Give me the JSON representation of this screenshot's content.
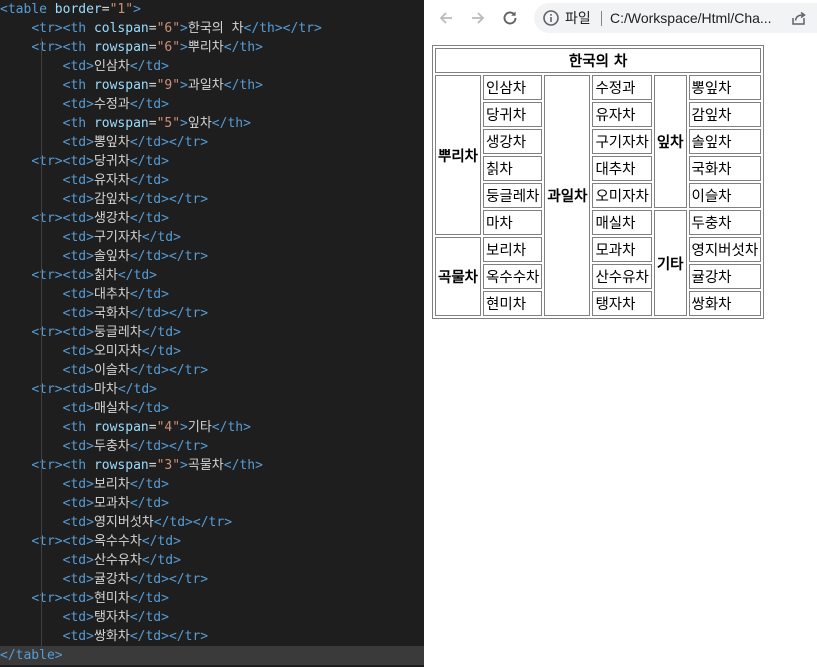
{
  "editor": {
    "lines": [
      [
        {
          "c": "t",
          "v": "<table "
        },
        {
          "c": "a",
          "v": "border"
        },
        {
          "c": "x",
          "v": "="
        },
        {
          "c": "s",
          "v": "\"1\""
        },
        {
          "c": "t",
          "v": ">"
        }
      ],
      [
        {
          "c": "x",
          "v": "    "
        },
        {
          "c": "t",
          "v": "<tr><th "
        },
        {
          "c": "a",
          "v": "colspan"
        },
        {
          "c": "x",
          "v": "="
        },
        {
          "c": "s",
          "v": "\"6\""
        },
        {
          "c": "t",
          "v": ">"
        },
        {
          "c": "x",
          "v": "한국의 차"
        },
        {
          "c": "t",
          "v": "</th></tr>"
        }
      ],
      [
        {
          "c": "x",
          "v": "    "
        },
        {
          "c": "t",
          "v": "<tr><th "
        },
        {
          "c": "a",
          "v": "rowspan"
        },
        {
          "c": "x",
          "v": "="
        },
        {
          "c": "s",
          "v": "\"6\""
        },
        {
          "c": "t",
          "v": ">"
        },
        {
          "c": "x",
          "v": "뿌리차"
        },
        {
          "c": "t",
          "v": "</th>"
        }
      ],
      [
        {
          "c": "x",
          "v": "        "
        },
        {
          "c": "t",
          "v": "<td>"
        },
        {
          "c": "x",
          "v": "인삼차"
        },
        {
          "c": "t",
          "v": "</td>"
        }
      ],
      [
        {
          "c": "x",
          "v": "        "
        },
        {
          "c": "t",
          "v": "<th "
        },
        {
          "c": "a",
          "v": "rowspan"
        },
        {
          "c": "x",
          "v": "="
        },
        {
          "c": "s",
          "v": "\"9\""
        },
        {
          "c": "t",
          "v": ">"
        },
        {
          "c": "x",
          "v": "과일차"
        },
        {
          "c": "t",
          "v": "</th>"
        }
      ],
      [
        {
          "c": "x",
          "v": "        "
        },
        {
          "c": "t",
          "v": "<td>"
        },
        {
          "c": "x",
          "v": "수정과"
        },
        {
          "c": "t",
          "v": "</td>"
        }
      ],
      [
        {
          "c": "x",
          "v": "        "
        },
        {
          "c": "t",
          "v": "<th "
        },
        {
          "c": "a",
          "v": "rowspan"
        },
        {
          "c": "x",
          "v": "="
        },
        {
          "c": "s",
          "v": "\"5\""
        },
        {
          "c": "t",
          "v": ">"
        },
        {
          "c": "x",
          "v": "잎차"
        },
        {
          "c": "t",
          "v": "</th>"
        }
      ],
      [
        {
          "c": "x",
          "v": "        "
        },
        {
          "c": "t",
          "v": "<td>"
        },
        {
          "c": "x",
          "v": "뽕잎차"
        },
        {
          "c": "t",
          "v": "</td></tr>"
        }
      ],
      [
        {
          "c": "x",
          "v": "    "
        },
        {
          "c": "t",
          "v": "<tr><td>"
        },
        {
          "c": "x",
          "v": "당귀차"
        },
        {
          "c": "t",
          "v": "</td>"
        }
      ],
      [
        {
          "c": "x",
          "v": "        "
        },
        {
          "c": "t",
          "v": "<td>"
        },
        {
          "c": "x",
          "v": "유자차"
        },
        {
          "c": "t",
          "v": "</td>"
        }
      ],
      [
        {
          "c": "x",
          "v": "        "
        },
        {
          "c": "t",
          "v": "<td>"
        },
        {
          "c": "x",
          "v": "감잎차"
        },
        {
          "c": "t",
          "v": "</td></tr>"
        }
      ],
      [
        {
          "c": "x",
          "v": "    "
        },
        {
          "c": "t",
          "v": "<tr><td>"
        },
        {
          "c": "x",
          "v": "생강차"
        },
        {
          "c": "t",
          "v": "</td>"
        }
      ],
      [
        {
          "c": "x",
          "v": "        "
        },
        {
          "c": "t",
          "v": "<td>"
        },
        {
          "c": "x",
          "v": "구기자차"
        },
        {
          "c": "t",
          "v": "</td>"
        }
      ],
      [
        {
          "c": "x",
          "v": "        "
        },
        {
          "c": "t",
          "v": "<td>"
        },
        {
          "c": "x",
          "v": "솔잎차"
        },
        {
          "c": "t",
          "v": "</td></tr>"
        }
      ],
      [
        {
          "c": "x",
          "v": "    "
        },
        {
          "c": "t",
          "v": "<tr><td>"
        },
        {
          "c": "x",
          "v": "칡차"
        },
        {
          "c": "t",
          "v": "</td>"
        }
      ],
      [
        {
          "c": "x",
          "v": "        "
        },
        {
          "c": "t",
          "v": "<td>"
        },
        {
          "c": "x",
          "v": "대추차"
        },
        {
          "c": "t",
          "v": "</td>"
        }
      ],
      [
        {
          "c": "x",
          "v": "        "
        },
        {
          "c": "t",
          "v": "<td>"
        },
        {
          "c": "x",
          "v": "국화차"
        },
        {
          "c": "t",
          "v": "</td></tr>"
        }
      ],
      [
        {
          "c": "x",
          "v": "    "
        },
        {
          "c": "t",
          "v": "<tr><td>"
        },
        {
          "c": "x",
          "v": "둥글레차"
        },
        {
          "c": "t",
          "v": "</td>"
        }
      ],
      [
        {
          "c": "x",
          "v": "        "
        },
        {
          "c": "t",
          "v": "<td>"
        },
        {
          "c": "x",
          "v": "오미자차"
        },
        {
          "c": "t",
          "v": "</td>"
        }
      ],
      [
        {
          "c": "x",
          "v": "        "
        },
        {
          "c": "t",
          "v": "<td>"
        },
        {
          "c": "x",
          "v": "이슬차"
        },
        {
          "c": "t",
          "v": "</td></tr>"
        }
      ],
      [
        {
          "c": "x",
          "v": "    "
        },
        {
          "c": "t",
          "v": "<tr><td>"
        },
        {
          "c": "x",
          "v": "마차"
        },
        {
          "c": "t",
          "v": "</td>"
        }
      ],
      [
        {
          "c": "x",
          "v": "        "
        },
        {
          "c": "t",
          "v": "<td>"
        },
        {
          "c": "x",
          "v": "매실차"
        },
        {
          "c": "t",
          "v": "</td>"
        }
      ],
      [
        {
          "c": "x",
          "v": "        "
        },
        {
          "c": "t",
          "v": "<th "
        },
        {
          "c": "a",
          "v": "rowspan"
        },
        {
          "c": "x",
          "v": "="
        },
        {
          "c": "s",
          "v": "\"4\""
        },
        {
          "c": "t",
          "v": ">"
        },
        {
          "c": "x",
          "v": "기타"
        },
        {
          "c": "t",
          "v": "</th>"
        }
      ],
      [
        {
          "c": "x",
          "v": "        "
        },
        {
          "c": "t",
          "v": "<td>"
        },
        {
          "c": "x",
          "v": "두충차"
        },
        {
          "c": "t",
          "v": "</td></tr>"
        }
      ],
      [
        {
          "c": "x",
          "v": "    "
        },
        {
          "c": "t",
          "v": "<tr><th "
        },
        {
          "c": "a",
          "v": "rowspan"
        },
        {
          "c": "x",
          "v": "="
        },
        {
          "c": "s",
          "v": "\"3\""
        },
        {
          "c": "t",
          "v": ">"
        },
        {
          "c": "x",
          "v": "곡물차"
        },
        {
          "c": "t",
          "v": "</th>"
        }
      ],
      [
        {
          "c": "x",
          "v": "        "
        },
        {
          "c": "t",
          "v": "<td>"
        },
        {
          "c": "x",
          "v": "보리차"
        },
        {
          "c": "t",
          "v": "</td>"
        }
      ],
      [
        {
          "c": "x",
          "v": "        "
        },
        {
          "c": "t",
          "v": "<td>"
        },
        {
          "c": "x",
          "v": "모과차"
        },
        {
          "c": "t",
          "v": "</td>"
        }
      ],
      [
        {
          "c": "x",
          "v": "        "
        },
        {
          "c": "t",
          "v": "<td>"
        },
        {
          "c": "x",
          "v": "영지버섯차"
        },
        {
          "c": "t",
          "v": "</td></tr>"
        }
      ],
      [
        {
          "c": "x",
          "v": "    "
        },
        {
          "c": "t",
          "v": "<tr><td>"
        },
        {
          "c": "x",
          "v": "옥수수차"
        },
        {
          "c": "t",
          "v": "</td>"
        }
      ],
      [
        {
          "c": "x",
          "v": "        "
        },
        {
          "c": "t",
          "v": "<td>"
        },
        {
          "c": "x",
          "v": "산수유차"
        },
        {
          "c": "t",
          "v": "</td>"
        }
      ],
      [
        {
          "c": "x",
          "v": "        "
        },
        {
          "c": "t",
          "v": "<td>"
        },
        {
          "c": "x",
          "v": "귤강차"
        },
        {
          "c": "t",
          "v": "</td></tr>"
        }
      ],
      [
        {
          "c": "x",
          "v": "    "
        },
        {
          "c": "t",
          "v": "<tr><td>"
        },
        {
          "c": "x",
          "v": "현미차"
        },
        {
          "c": "t",
          "v": "</td>"
        }
      ],
      [
        {
          "c": "x",
          "v": "        "
        },
        {
          "c": "t",
          "v": "<td>"
        },
        {
          "c": "x",
          "v": "탱자차"
        },
        {
          "c": "t",
          "v": "</td>"
        }
      ],
      [
        {
          "c": "x",
          "v": "        "
        },
        {
          "c": "t",
          "v": "<td>"
        },
        {
          "c": "x",
          "v": "쌍화차"
        },
        {
          "c": "t",
          "v": "</td></tr>"
        }
      ],
      [
        {
          "c": "t",
          "v": "</table>"
        }
      ]
    ]
  },
  "browser": {
    "scheme_label": "파일",
    "url": "C:/Workspace/Html/Cha..."
  },
  "table": {
    "rows": [
      [
        {
          "tag": "th",
          "text": "한국의 차",
          "colspan": 6
        }
      ],
      [
        {
          "tag": "th",
          "text": "뿌리차",
          "rowspan": 6
        },
        {
          "tag": "td",
          "text": "인삼차"
        },
        {
          "tag": "th",
          "text": "과일차",
          "rowspan": 9
        },
        {
          "tag": "td",
          "text": "수정과"
        },
        {
          "tag": "th",
          "text": "잎차",
          "rowspan": 5
        },
        {
          "tag": "td",
          "text": "뽕잎차"
        }
      ],
      [
        {
          "tag": "td",
          "text": "당귀차"
        },
        {
          "tag": "td",
          "text": "유자차"
        },
        {
          "tag": "td",
          "text": "감잎차"
        }
      ],
      [
        {
          "tag": "td",
          "text": "생강차"
        },
        {
          "tag": "td",
          "text": "구기자차"
        },
        {
          "tag": "td",
          "text": "솔잎차"
        }
      ],
      [
        {
          "tag": "td",
          "text": "칡차"
        },
        {
          "tag": "td",
          "text": "대추차"
        },
        {
          "tag": "td",
          "text": "국화차"
        }
      ],
      [
        {
          "tag": "td",
          "text": "둥글레차"
        },
        {
          "tag": "td",
          "text": "오미자차"
        },
        {
          "tag": "td",
          "text": "이슬차"
        }
      ],
      [
        {
          "tag": "td",
          "text": "마차"
        },
        {
          "tag": "td",
          "text": "매실차"
        },
        {
          "tag": "th",
          "text": "기타",
          "rowspan": 4
        },
        {
          "tag": "td",
          "text": "두충차"
        }
      ],
      [
        {
          "tag": "th",
          "text": "곡물차",
          "rowspan": 3
        },
        {
          "tag": "td",
          "text": "보리차"
        },
        {
          "tag": "td",
          "text": "모과차"
        },
        {
          "tag": "td",
          "text": "영지버섯차"
        }
      ],
      [
        {
          "tag": "td",
          "text": "옥수수차"
        },
        {
          "tag": "td",
          "text": "산수유차"
        },
        {
          "tag": "td",
          "text": "귤강차"
        }
      ],
      [
        {
          "tag": "td",
          "text": "현미차"
        },
        {
          "tag": "td",
          "text": "탱자차"
        },
        {
          "tag": "td",
          "text": "쌍화차"
        }
      ]
    ]
  }
}
